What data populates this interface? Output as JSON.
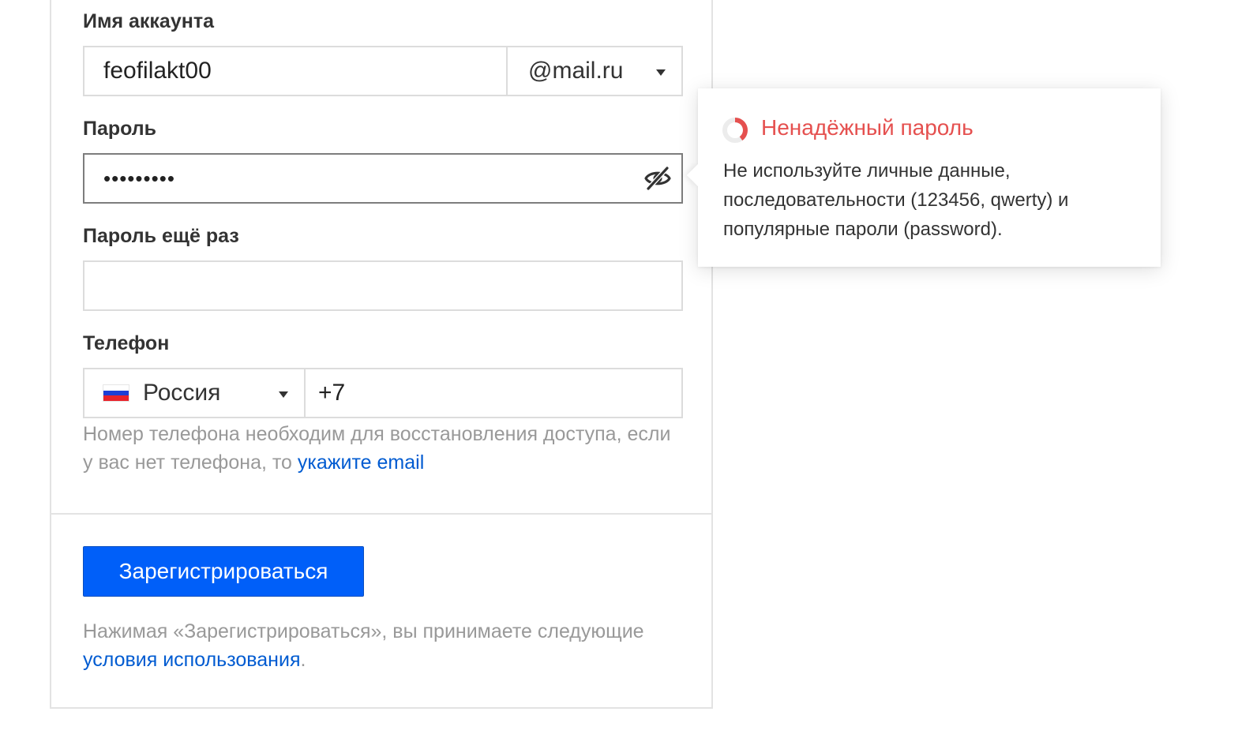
{
  "form": {
    "account_label": "Имя аккаунта",
    "account_value": "feofilakt00",
    "domain_value": "@mail.ru",
    "password_label": "Пароль",
    "password_value": "•••••••••",
    "password_repeat_label": "Пароль ещё раз",
    "password_repeat_value": "",
    "phone_label": "Телефон",
    "country_value": "Россия",
    "phone_value": "+7",
    "phone_hint_text": "Номер телефона необходим для восстановления доступа, если у вас нет телефона, то ",
    "phone_hint_link": "укажите email",
    "submit_label": "Зарегистрироваться",
    "terms_text": "Нажимая «Зарегистрироваться», вы принимаете следующие ",
    "terms_link": "условия использования",
    "terms_end": "."
  },
  "tooltip": {
    "title": "Ненадёжный пароль",
    "body": "Не используйте личные данные, последовательности (123456, qwerty) и популярные пароли (password).",
    "strength_color": "#e5504f"
  },
  "icons": {
    "password_toggle": "eye-crossed-icon",
    "strength": "strength-ring-icon",
    "flag": "russia-flag-icon"
  },
  "colors": {
    "accent": "#005ff9",
    "link": "#005bd1",
    "warning": "#e5504f",
    "hint": "#999999"
  }
}
